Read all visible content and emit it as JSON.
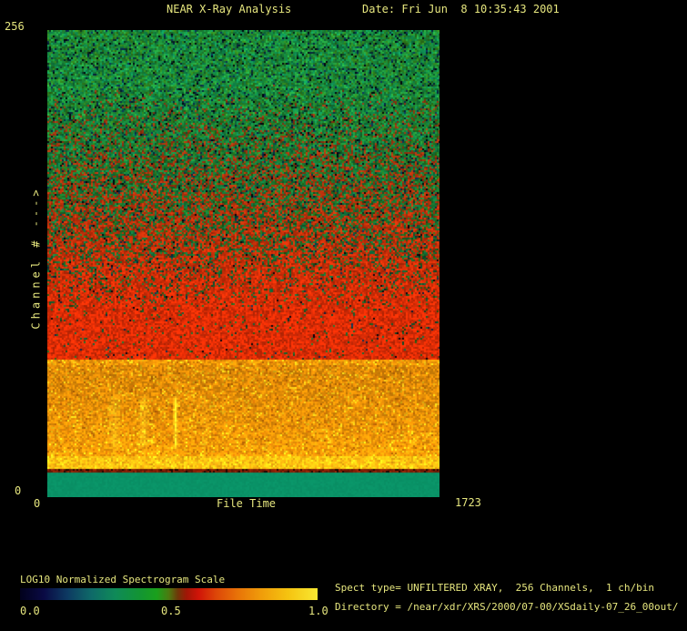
{
  "colors": {
    "background": "#000000",
    "text": "#e6e67e",
    "flat_band": "#0a9468",
    "divider_band": "#7c1e06"
  },
  "header": {
    "title": "NEAR X-Ray Analysis",
    "date_label": "Date: Fri Jun  8 10:35:43 2001"
  },
  "plot": {
    "y_axis": {
      "label": "Channel # --->",
      "top_tick": "256",
      "bottom_tick": "0"
    },
    "x_axis": {
      "label": "File Time",
      "left_tick": "0",
      "right_tick": "1723"
    }
  },
  "legend": {
    "title": "LOG10 Normalized Spectrogram Scale",
    "ticks": [
      "0.0",
      "0.5",
      "1.0"
    ]
  },
  "info": {
    "line1": "Spect type= UNFILTERED XRAY,  256 Channels,  1 ch/bin",
    "line2": "Directory = /near/xdr/XRS/2000/07-00/XSdaily-07_26_00out/"
  },
  "chart_data": {
    "type": "heatmap",
    "title": "NEAR X-Ray Analysis",
    "xlabel": "File Time",
    "ylabel": "Channel # --->",
    "x_range": [
      0,
      1723
    ],
    "y_range": [
      0,
      256
    ],
    "channels": 256,
    "channels_per_bin": 1,
    "spect_type": "UNFILTERED XRAY",
    "scale": {
      "label": "LOG10 Normalized Spectrogram Scale",
      "range": [
        0.0,
        1.0
      ],
      "colorbar_stops": [
        [
          "#01011c",
          0
        ],
        [
          "#0a0a44",
          8
        ],
        [
          "#0d3a62",
          16
        ],
        [
          "#0e6a68",
          24
        ],
        [
          "#0f8a58",
          32
        ],
        [
          "#129434",
          40
        ],
        [
          "#1aa01c",
          46
        ],
        [
          "#4c7a10",
          50
        ],
        [
          "#6e3808",
          53
        ],
        [
          "#a01606",
          56
        ],
        [
          "#d01408",
          60
        ],
        [
          "#dd4708",
          66
        ],
        [
          "#e87208",
          73
        ],
        [
          "#f09c0a",
          81
        ],
        [
          "#f5c310",
          90
        ],
        [
          "#f8e832",
          100
        ]
      ]
    },
    "bands": [
      {
        "id": "gradient-zone",
        "ch_top": 256,
        "ch_bottom": 75.5,
        "description": "noisy green (high channels) grading into solid red",
        "green_colors": [
          "#1c8c36",
          "#117a3c",
          "#23993e",
          "#0e8a52",
          "#2e7c1c"
        ],
        "dark_speck_colors": [
          "#00040e",
          "#07203e",
          "#0a2e4e",
          "#083222"
        ],
        "red_dark": "#8a3410",
        "red_bright": "#d82c06",
        "red_onset_ch": 226,
        "red_full_ch": 101
      },
      {
        "id": "orange-band",
        "ch_top": 75.5,
        "ch_bottom": 15.5,
        "description": "bright orange band, yellowing toward low channels",
        "base": "#e28c08",
        "yellow_speck": "#f4c216",
        "dark_speck": "#c06a06",
        "bottom_yellow": "#f2c818",
        "streak_color": "#fae22a"
      },
      {
        "id": "divider-line",
        "ch_top": 15.5,
        "ch_bottom": 13.5,
        "base": "#7c1e06",
        "description": "thin dark red divider"
      },
      {
        "id": "flat-teal",
        "ch_top": 13.5,
        "ch_bottom": 0,
        "base": "#0a9468",
        "description": "flat teal strip at lowest channels"
      }
    ],
    "streaks": [
      {
        "t_center": 296,
        "t_halfwidth": 34,
        "ch_top": 58,
        "ch_bottom": 24,
        "intensity": 0.35
      },
      {
        "t_center": 424,
        "t_halfwidth": 28,
        "ch_top": 58,
        "ch_bottom": 24,
        "intensity": 0.4
      },
      {
        "t_center": 564,
        "t_halfwidth": 12,
        "ch_top": 58,
        "ch_bottom": 24,
        "intensity": 0.9
      },
      {
        "t_center": 692,
        "t_halfwidth": 28,
        "ch_top": 58,
        "ch_bottom": 24,
        "intensity": 0.12
      }
    ]
  }
}
